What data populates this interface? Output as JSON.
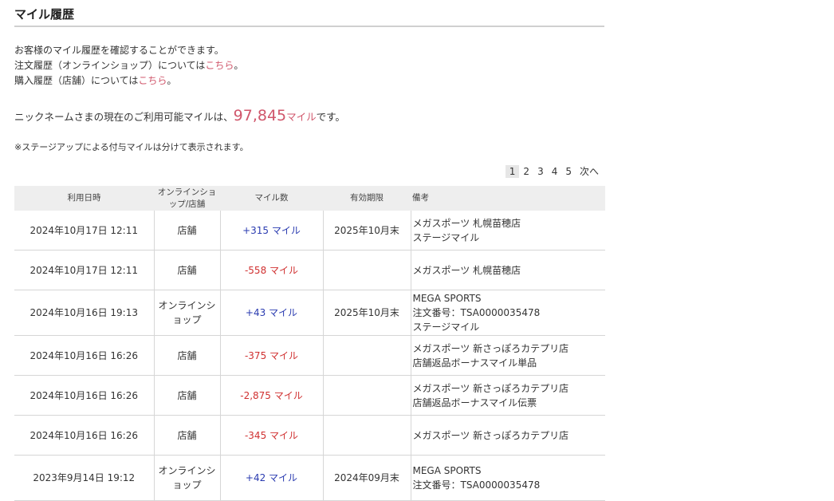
{
  "title": "マイル履歴",
  "intro": {
    "line1": "お客様のマイル履歴を確認することができます。",
    "line2_prefix": "注文履歴（オンラインショップ）については",
    "line2_link": "こちら",
    "line2_suffix": "。",
    "line3_prefix": "購入履歴（店舗）については",
    "line3_link": "こちら",
    "line3_suffix": "。"
  },
  "balance": {
    "prefix": "ニックネームさまの現在のご利用可能マイルは、",
    "value": "97,845",
    "unit": "マイル",
    "suffix": "です。"
  },
  "note": "※ステージアップによる付与マイルは分けて表示されます。",
  "pager": {
    "pages": [
      "1",
      "2",
      "3",
      "4",
      "5"
    ],
    "current": "1",
    "next": "次へ"
  },
  "table": {
    "headers": {
      "date": "利用日時",
      "channel": "オンラインショップ/店舗",
      "miles": "マイル数",
      "expiry": "有効期限",
      "remark": "備考"
    },
    "rows": [
      {
        "date": "2024年10月17日 12:11",
        "channel": "店舗",
        "miles": "+315 マイル",
        "sign": "plus",
        "expiry": "2025年10月末",
        "remark1": "メガスポーツ 札幌苗穂店",
        "remark2": "ステージマイル",
        "remark3": ""
      },
      {
        "date": "2024年10月17日 12:11",
        "channel": "店舗",
        "miles": "-558 マイル",
        "sign": "minus",
        "expiry": "",
        "remark1": "メガスポーツ 札幌苗穂店",
        "remark2": "",
        "remark3": ""
      },
      {
        "date": "2024年10月16日 19:13",
        "channel": "オンラインショップ",
        "miles": "+43 マイル",
        "sign": "plus",
        "expiry": "2025年10月末",
        "remark1": "MEGA SPORTS",
        "remark2": "注文番号：TSA0000035478",
        "remark3": "ステージマイル"
      },
      {
        "date": "2024年10月16日 16:26",
        "channel": "店舗",
        "miles": "-375 マイル",
        "sign": "minus",
        "expiry": "",
        "remark1": "メガスポーツ 新さっぽろカテプリ店",
        "remark2": "店舗返品ボーナスマイル単品",
        "remark3": ""
      },
      {
        "date": "2024年10月16日 16:26",
        "channel": "店舗",
        "miles": "-2,875 マイル",
        "sign": "minus",
        "expiry": "",
        "remark1": "メガスポーツ 新さっぽろカテプリ店",
        "remark2": "店舗返品ボーナスマイル伝票",
        "remark3": ""
      },
      {
        "date": "2024年10月16日 16:26",
        "channel": "店舗",
        "miles": "-345 マイル",
        "sign": "minus",
        "expiry": "",
        "remark1": "メガスポーツ 新さっぽろカテプリ店",
        "remark2": "",
        "remark3": ""
      },
      {
        "date": "2023年9月14日 19:12",
        "channel": "オンラインショップ",
        "miles": "+42 マイル",
        "sign": "plus",
        "expiry": "2024年09月末",
        "remark1": "MEGA SPORTS",
        "remark2": "注文番号：TSA0000035478",
        "remark3": ""
      }
    ]
  }
}
